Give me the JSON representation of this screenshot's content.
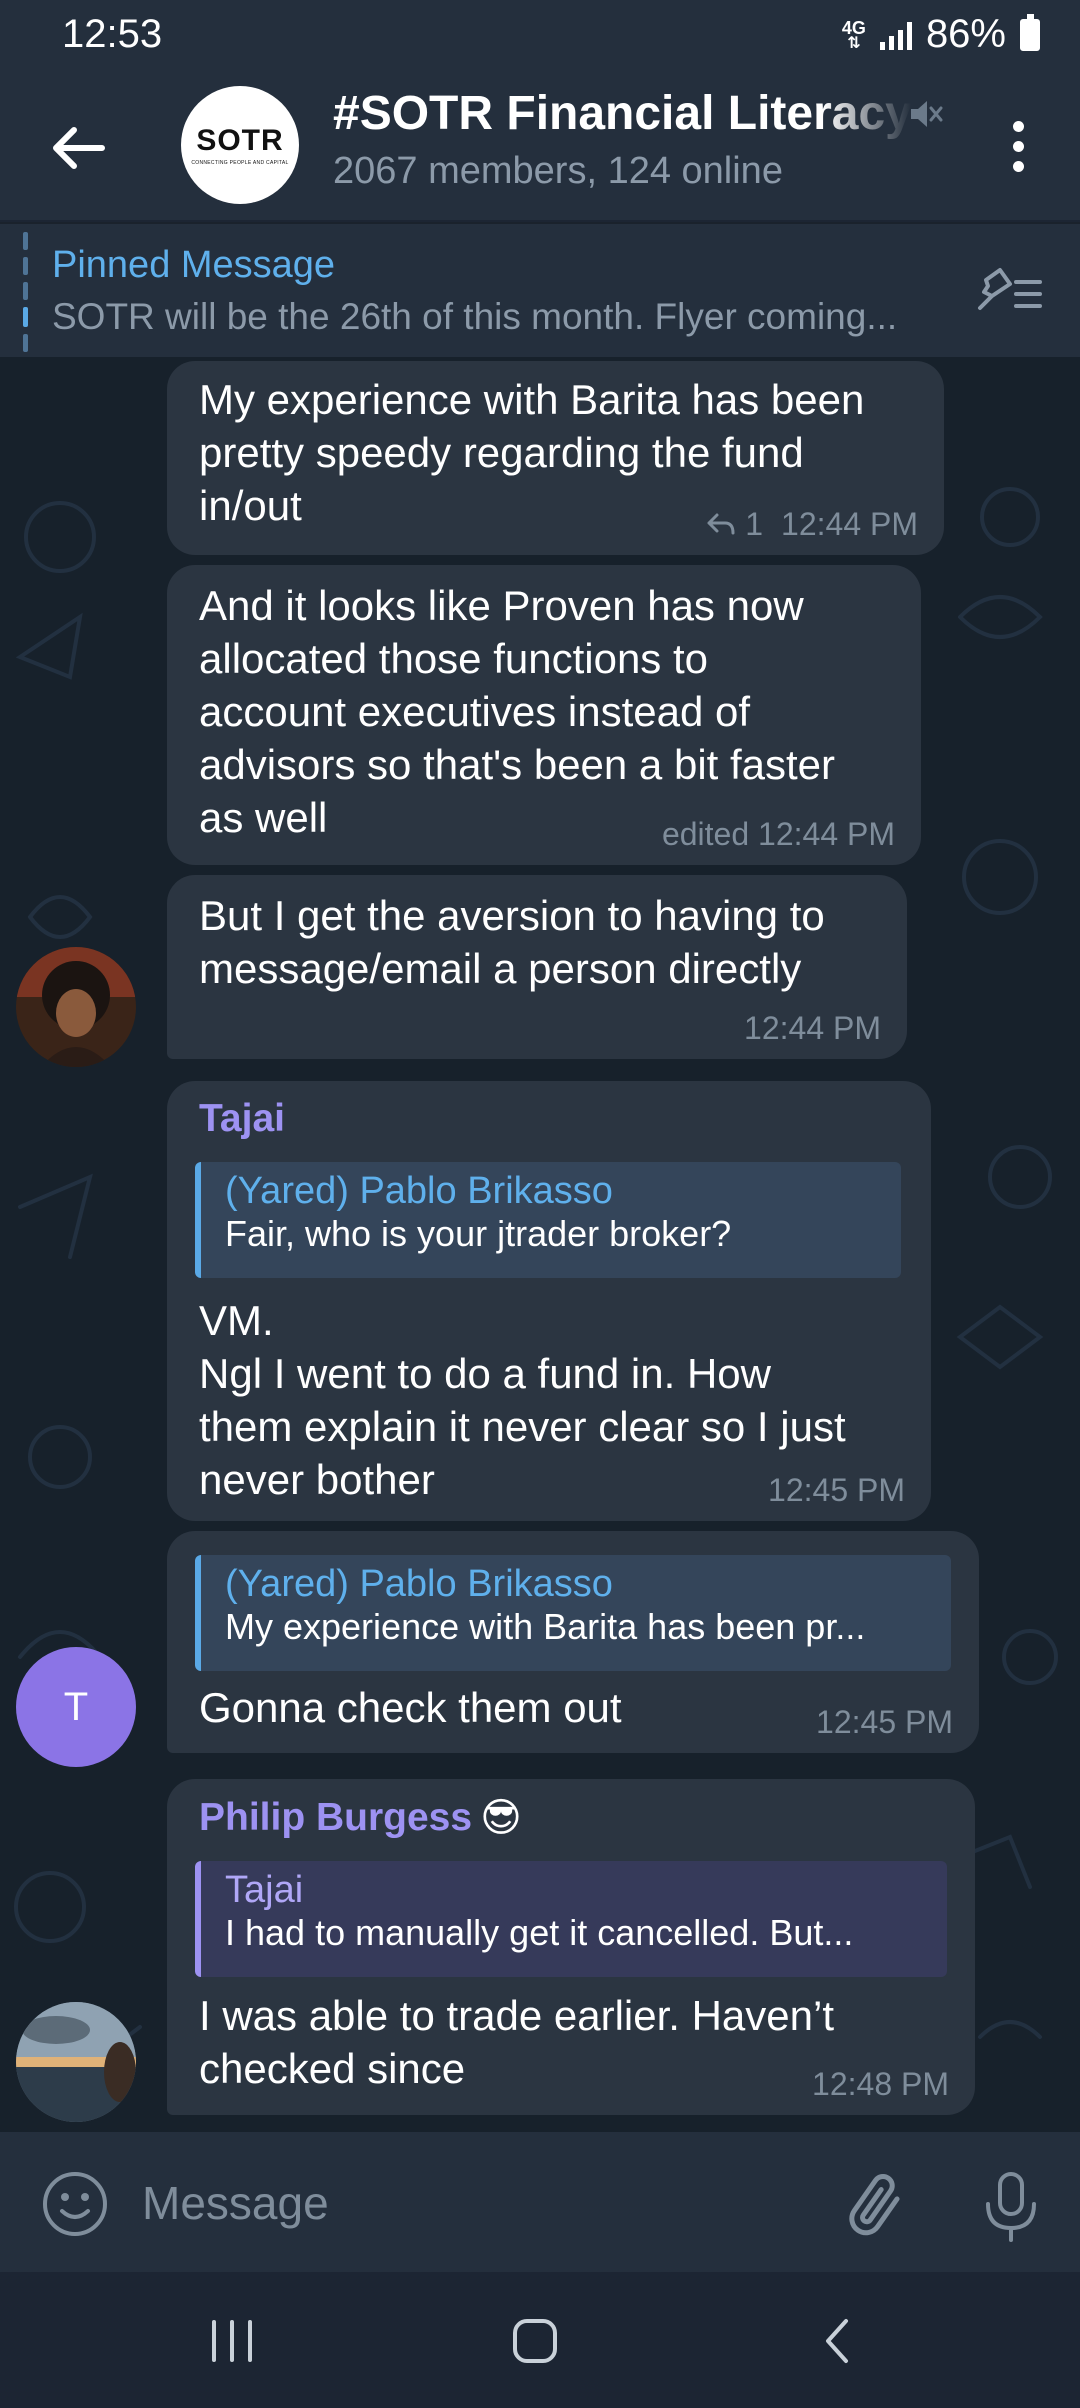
{
  "status_bar": {
    "time": "12:53",
    "network": "4G",
    "battery": "86%"
  },
  "header": {
    "title": "#SOTR Financial Literacy",
    "subtitle": "2067 members, 124 online",
    "logo_text": "SOTR",
    "logo_tagline": "CONNECTING PEOPLE AND CAPITAL"
  },
  "pinned": {
    "title": "Pinned Message",
    "text": "SOTR will be the 26th of this month. Flyer coming..."
  },
  "messages": [
    {
      "text": "My experience with Barita has been\npretty speedy regarding the fund\nin/out",
      "reply_count": "1",
      "time": "12:44 PM"
    },
    {
      "text": "And it looks like Proven has now\nallocated those functions to\naccount executives instead of\nadvisors so that's been a bit faster\nas well",
      "time": "edited 12:44 PM"
    },
    {
      "text": "But I get the aversion to having to\nmessage/email a person directly",
      "time": "12:44 PM"
    },
    {
      "sender": "Tajai",
      "quote_name": "(Yared) Pablo Brikasso",
      "quote_text": "Fair, who is your jtrader broker?",
      "text": "VM.\nNgl I went to do a fund in. How\nthem explain it never clear so I just\nnever bother",
      "time": "12:45 PM"
    },
    {
      "quote_name": "(Yared) Pablo Brikasso",
      "quote_text": "My experience with Barita has been pr...",
      "text": "Gonna check them out",
      "time": "12:45 PM",
      "avatar_letter": "T"
    },
    {
      "sender": "Philip Burgess",
      "sender_emoji": "😎",
      "quote_name": "Tajai",
      "quote_text": "I had to manually get it cancelled. But...",
      "text": "I was able to trade earlier. Haven’t\nchecked since",
      "time": "12:48 PM"
    }
  ],
  "input": {
    "placeholder": "Message"
  },
  "colors": {
    "accent": "#5fb0ec",
    "bubble": "#2b3541",
    "sender": "#9d92f2"
  }
}
